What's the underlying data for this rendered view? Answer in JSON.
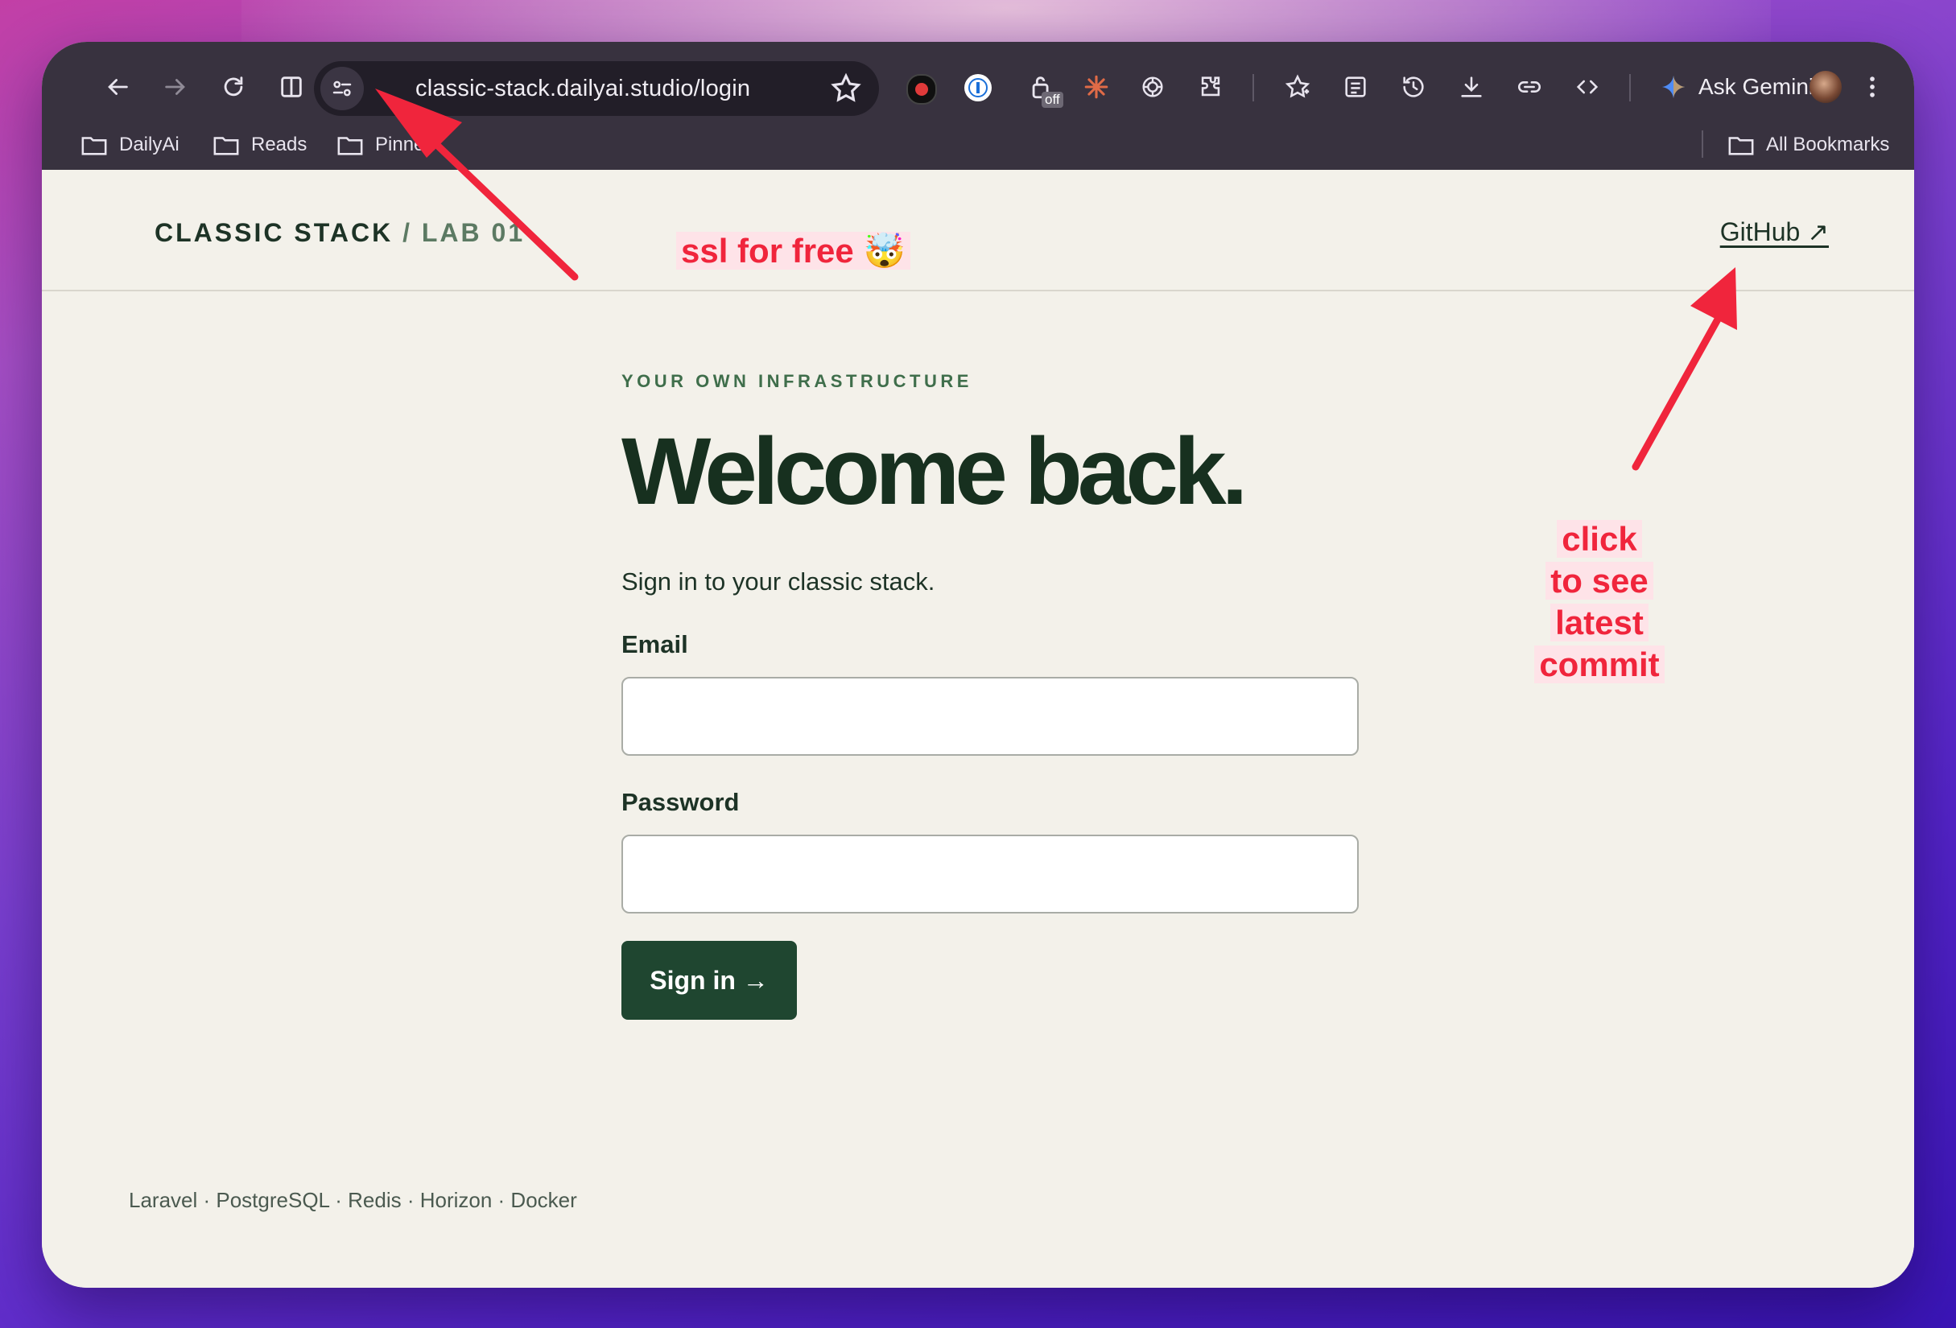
{
  "browser": {
    "url": "classic-stack.dailyai.studio/login",
    "ask_gemini": "Ask Gemini",
    "extension_badge": "off",
    "bookmarks": [
      {
        "label": "DailyAi"
      },
      {
        "label": "Reads"
      },
      {
        "label": "Pinned"
      }
    ],
    "all_bookmarks": "All Bookmarks"
  },
  "header": {
    "brand": "CLASSIC STACK",
    "brand_sep": " / ",
    "brand_sub": "LAB 01",
    "github_link": "GitHub ↗"
  },
  "main": {
    "eyebrow": "YOUR OWN INFRASTRUCTURE",
    "headline": "Welcome back.",
    "lede": "Sign in to your classic stack.",
    "email_label": "Email",
    "password_label": "Password",
    "signin_button": "Sign in →"
  },
  "footer": {
    "stack": "Laravel · PostgreSQL · Redis · Horizon · Docker"
  },
  "annotations": {
    "ssl_text": "ssl for free",
    "ssl_emoji": "🤯",
    "click_lines": [
      "click",
      "to see",
      "latest",
      "commit"
    ],
    "color": "#f0253c"
  }
}
